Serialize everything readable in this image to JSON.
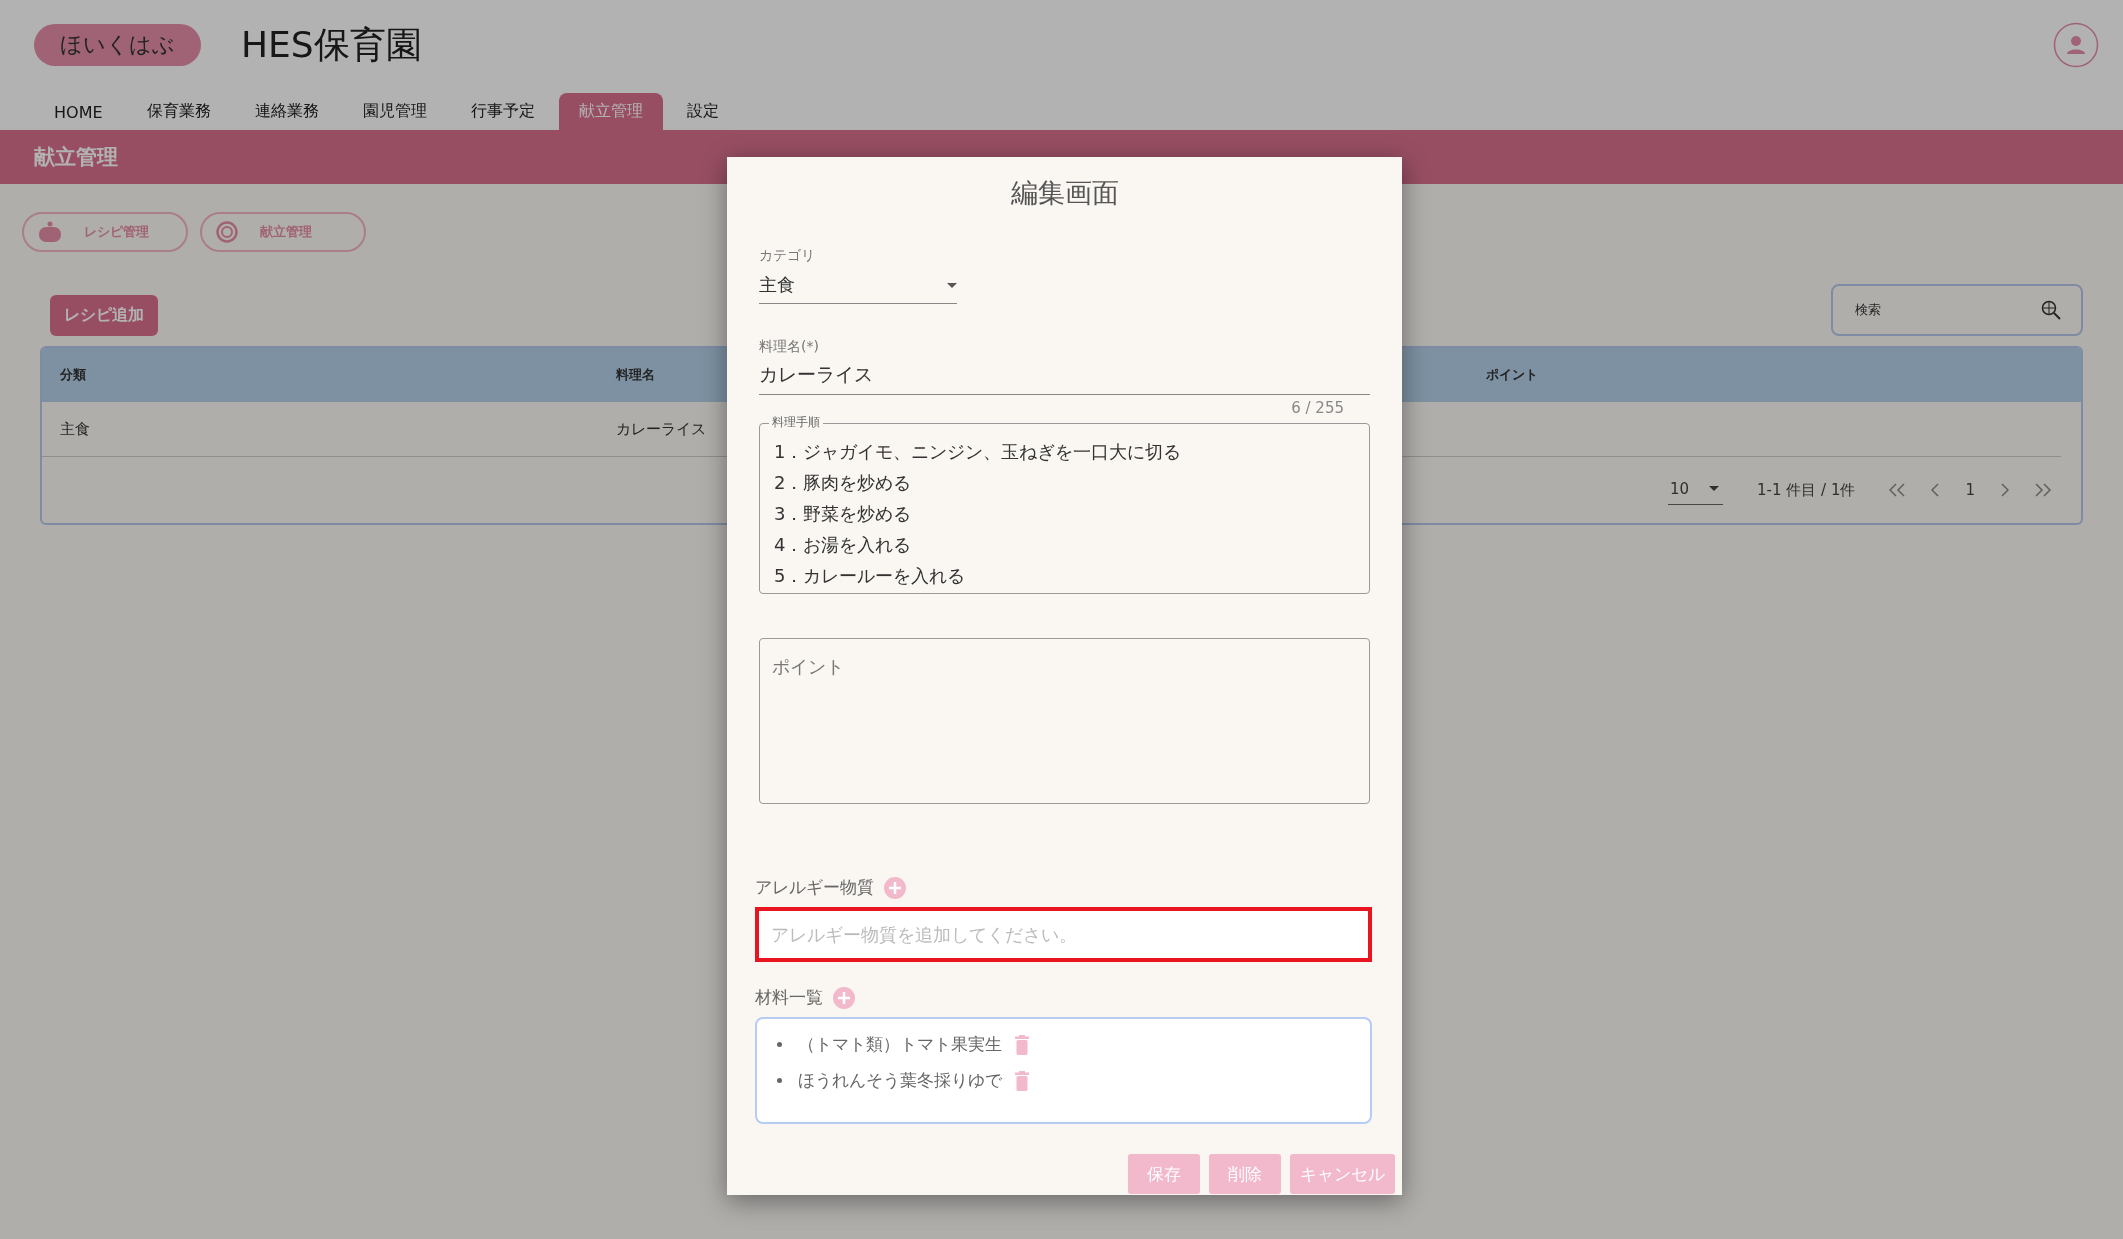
{
  "header": {
    "logo": "ほいくはぶ",
    "title": "HES保育園"
  },
  "nav": [
    {
      "label": "HOME",
      "selected": false
    },
    {
      "label": "保育業務",
      "selected": false
    },
    {
      "label": "連絡業務",
      "selected": false
    },
    {
      "label": "園児管理",
      "selected": false
    },
    {
      "label": "行事予定",
      "selected": false
    },
    {
      "label": "献立管理",
      "selected": true
    },
    {
      "label": "設定",
      "selected": false
    }
  ],
  "page_title": "献立管理",
  "sub_nav": [
    {
      "label": "レシピ管理",
      "kind": "pot"
    },
    {
      "label": "献立管理",
      "kind": "plate"
    }
  ],
  "add_button": "レシピ追加",
  "search": {
    "placeholder": "検索"
  },
  "table": {
    "columns": [
      "分類",
      "料理名",
      "ポイント"
    ],
    "rows": [
      {
        "cells": [
          "主食",
          "カレーライス"
        ]
      }
    ],
    "pagination": {
      "rows_per_page": "10",
      "range": "1-1 件目 / 1件",
      "page": "1"
    }
  },
  "dialog": {
    "title": "編集画面",
    "category": {
      "label": "カテゴリ",
      "value": "主食"
    },
    "name": {
      "label": "料理名(*)",
      "value": "カレーライス",
      "counter": "6 / 255"
    },
    "steps": {
      "label": "料理手順",
      "lines": [
        "1．ジャガイモ、ニンジン、玉ねぎを一口大に切る",
        "2．豚肉を炒める",
        "3．野菜を炒める",
        "4．お湯を入れる",
        "5．カレールーを入れる"
      ]
    },
    "point": {
      "placeholder": "ポイント"
    },
    "allergy": {
      "label": "アレルギー物質",
      "placeholder": "アレルギー物質を追加してください。",
      "error": true
    },
    "ingredients": {
      "label": "材料一覧",
      "items": [
        "（トマト類）トマト果実生",
        "ほうれんそう葉冬採りゆで"
      ]
    },
    "buttons": [
      "保存",
      "削除",
      "キャンセル"
    ]
  }
}
